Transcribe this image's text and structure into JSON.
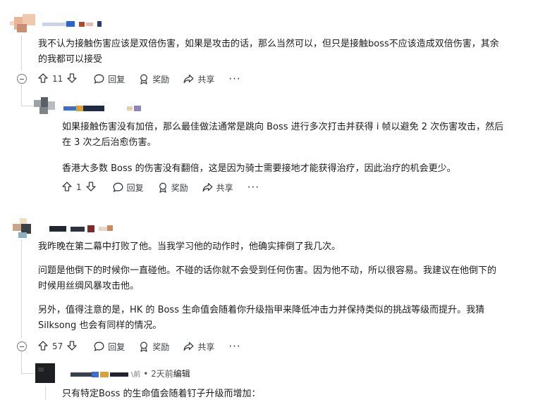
{
  "comments": [
    {
      "id": "c1",
      "body": [
        "我不认为接触伤害应该是双倍伤害，如果是攻击的话，那么当然可以，但只是接触boss不应该造成双倍伤害，其余",
        "的我都可以接受"
      ],
      "votes": "11",
      "reply_label": "回复",
      "award_label": "奖励",
      "share_label": "共享"
    },
    {
      "id": "c1r1",
      "body_p1": [
        "如果接触伤害没有加倍，那么最佳做法通常是跳向 Boss 进行多次打击并获得 i 帧以避免 2 次伤害攻击，然后",
        "在 3 次之后治愈伤害。"
      ],
      "body_p2": "香港大多数 Boss 的伤害没有翻倍，这是因为骑士需要接地才能获得治疗，因此治疗的机会更少。",
      "votes": "1",
      "reply_label": "回复",
      "award_label": "奖励",
      "share_label": "共享"
    },
    {
      "id": "c2",
      "body_p1": "我昨晚在第二幕中打败了他。当我学习他的动作时，他确实摔倒了我几次。",
      "body_p2": [
        "问题是他倒下的时候你一直碰他。不碰的话你就不会受到任何伤害。因为他不动，所以很容易。我建议在他倒下的",
        "时候用丝绸风暴攻击他。"
      ],
      "body_p3": [
        "另外，值得注意的是，HK 的 Boss 生命值会随着你升级指甲来降低冲击力并保持类似的挑战等级而提升。我猜",
        "Silksong 也会有同样的情况。"
      ],
      "votes": "57",
      "reply_label": "回复",
      "award_label": "奖励",
      "share_label": "共享"
    },
    {
      "id": "c2r1",
      "meta_prefix": "\\前",
      "meta_time": "• 2天前",
      "meta_edited": "编辑",
      "body": "只有特定Boss 的生命值会随着钉子升级而增加："
    }
  ],
  "colors": {
    "text": "#1c1c1c",
    "meta": "#555555",
    "thread_line": "#d6d6d6",
    "icon": "#3a3d40"
  }
}
